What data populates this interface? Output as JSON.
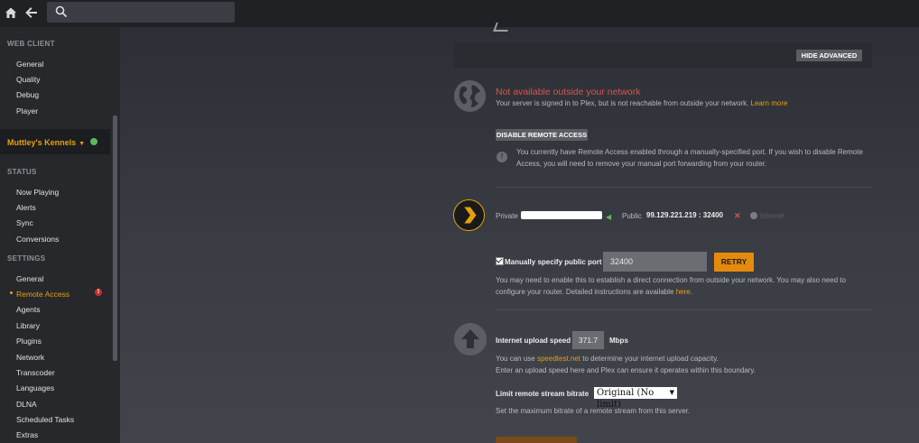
{
  "sidebar": {
    "web_client_header": "WEB CLIENT",
    "web_client_items": [
      "General",
      "Quality",
      "Debug",
      "Player"
    ],
    "server_name": "Muttley's Kennels",
    "status_header": "STATUS",
    "status_items": [
      "Now Playing",
      "Alerts",
      "Sync",
      "Conversions"
    ],
    "settings_header": "SETTINGS",
    "settings_items": [
      "General",
      "Remote Access",
      "Agents",
      "Library",
      "Plugins",
      "Network",
      "Transcoder",
      "Languages",
      "DLNA",
      "Scheduled Tasks",
      "Extras"
    ],
    "active_item": "Remote Access"
  },
  "remote": {
    "hide_advanced": "HIDE ADVANCED",
    "status_title": "Not available outside your network",
    "status_desc": "Your server is signed in to Plex, but is not reachable from outside your network.",
    "learn_more": "Learn more",
    "disable_button": "DISABLE REMOTE ACCESS",
    "disable_note_1": "You currently have Remote Access enabled through a manually-specified port. If you wish to disable Remote",
    "disable_note_2": "Access, you will need to remove your manual port forwarding from your router.",
    "private_label": "Private",
    "public_label": "Public",
    "public_ip": "99.129.221.219",
    "port_sep": ":",
    "public_port": "32400",
    "internet_label": "Internet",
    "manual_port_label": "Manually specify public port",
    "port_value": "32400",
    "retry_button": "RETRY",
    "port_note_1": "You may need to enable this to establish a direct connection from outside your network. You may also need to",
    "port_note_2": "configure your router. Detailed instructions are available",
    "here_link": "here",
    "upload_label": "Internet upload speed",
    "upload_value": "371.7",
    "upload_unit": "Mbps",
    "speed_note_pre": "You can use",
    "speedtest_link": "speedtest.net",
    "speed_note_post": "to determine your internet upload capacity.",
    "speed_note_2": "Enter an upload speed here and Plex can ensure it operates within this boundary.",
    "bitrate_label": "Limit remote stream bitrate",
    "bitrate_value": "Original (No limit)",
    "bitrate_note": "Set the maximum bitrate of a remote stream from this server."
  },
  "colors": {
    "accent": "#e5a00d",
    "error": "#d9534f",
    "ok": "#5cb85c"
  },
  "icons": [
    "home-icon",
    "back-arrow-icon",
    "search-icon",
    "globe-icon",
    "plex-logo-icon",
    "upload-arrow-icon",
    "info-icon"
  ]
}
